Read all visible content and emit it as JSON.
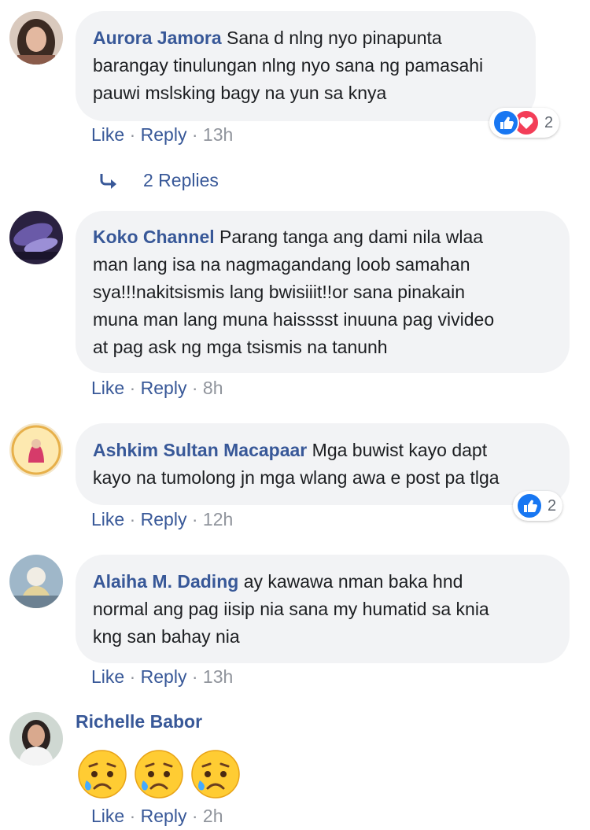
{
  "comments": [
    {
      "author": "Aurora Jamora",
      "text": "Sana d nlng nyo pinapunta barangay tinulungan nlng nyo sana ng pamasahi pauwi mslsking bagy na yun sa knya",
      "lines": [
        "Sana d nlng nyo pinapunta",
        "barangay tinulungan nlng nyo sana ng pamasahi",
        "pauwi mslsking bagy na yun sa knya"
      ],
      "like": "Like",
      "reply": "Reply",
      "time": "13h",
      "reactions": [
        "like",
        "love"
      ],
      "reaction_count": "2"
    },
    {
      "author": "Koko Channel",
      "text": "Parang tanga ang dami nila wlaa man lang isa na nagmagandang loob samahan sya!!!nakitsismis lang bwisiiit!!or sana pinakain muna man lang muna haisssst inuuna pag vivideo at pag ask ng mga tsismis na tanunh",
      "lines": [
        "Parang tanga ang dami nila wlaa",
        "man lang isa na nagmagandang loob samahan",
        "sya!!!nakitsismis lang bwisiiit!!or sana pinakain",
        "muna man lang muna haisssst inuuna pag vivideo",
        "at pag ask ng mga tsismis na tanunh"
      ],
      "like": "Like",
      "reply": "Reply",
      "time": "8h"
    },
    {
      "author": "Ashkim Sultan Macapaar",
      "text": "Mga buwist kayo dapt kayo na tumolong jn mga wlang awa e post pa tlga",
      "lines": [
        "Mga buwist kayo dapt",
        "kayo na tumolong jn mga wlang awa e post pa tlga"
      ],
      "like": "Like",
      "reply": "Reply",
      "time": "12h",
      "reactions": [
        "like"
      ],
      "reaction_count": "2"
    },
    {
      "author": "Alaiha M. Dading",
      "text": "ay kawawa nman baka hnd normal ang pag iisip nia sana my humatid sa knia kng san bahay nia",
      "lines": [
        "ay kawawa nman baka hnd",
        "normal ang pag iisip nia sana my humatid sa knia",
        "kng san bahay nia"
      ],
      "like": "Like",
      "reply": "Reply",
      "time": "13h"
    },
    {
      "author": "Richelle Babor",
      "emojis": [
        "crying-face",
        "crying-face",
        "crying-face"
      ],
      "like": "Like",
      "reply": "Reply",
      "time": "2h"
    }
  ],
  "replies_link": "2 Replies",
  "separator": "·",
  "colors": {
    "link": "#385898",
    "bubble": "#f2f3f5",
    "meta": "#90949c",
    "like": "#1877f2",
    "love": "#f33e58"
  }
}
